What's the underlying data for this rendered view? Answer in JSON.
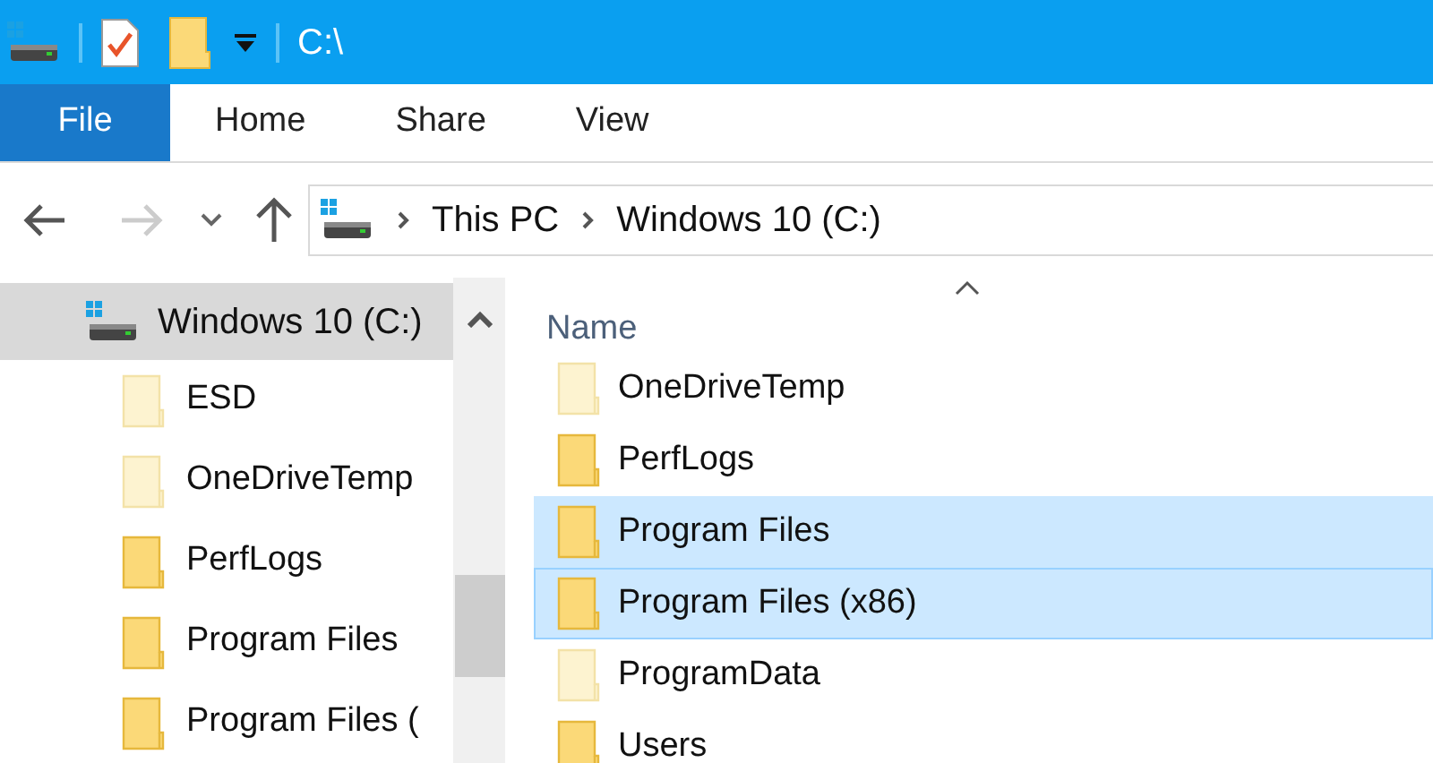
{
  "window": {
    "title": "C:\\"
  },
  "tabs": [
    {
      "label": "File",
      "kind": "file",
      "selected": false
    },
    {
      "label": "Home",
      "kind": "tab",
      "selected": false
    },
    {
      "label": "Share",
      "kind": "tab",
      "selected": false
    },
    {
      "label": "View",
      "kind": "tab",
      "selected": false
    }
  ],
  "address": {
    "path": [
      "This PC",
      "Windows 10 (C:)"
    ]
  },
  "sidebar": {
    "items": [
      {
        "label": "Windows 10 (C:)",
        "selected": true,
        "children": [
          {
            "label": "ESD",
            "hidden": true,
            "selected": false
          },
          {
            "label": "OneDriveTemp",
            "hidden": true,
            "selected": false
          },
          {
            "label": "PerfLogs",
            "hidden": false,
            "selected": false
          },
          {
            "label": "Program Files",
            "hidden": false,
            "selected": false
          },
          {
            "label": "Program Files (",
            "hidden": false,
            "selected": false
          }
        ]
      }
    ]
  },
  "file_list": {
    "columns": [
      "Name"
    ],
    "rows": [
      {
        "name": "OneDriveTemp",
        "hidden": true,
        "selected": false
      },
      {
        "name": "PerfLogs",
        "hidden": false,
        "selected": false
      },
      {
        "name": "Program Files",
        "hidden": false,
        "selected": true
      },
      {
        "name": "Program Files (x86)",
        "hidden": false,
        "selected": true
      },
      {
        "name": "ProgramData",
        "hidden": true,
        "selected": false
      },
      {
        "name": "Users",
        "hidden": false,
        "selected": false
      }
    ]
  }
}
